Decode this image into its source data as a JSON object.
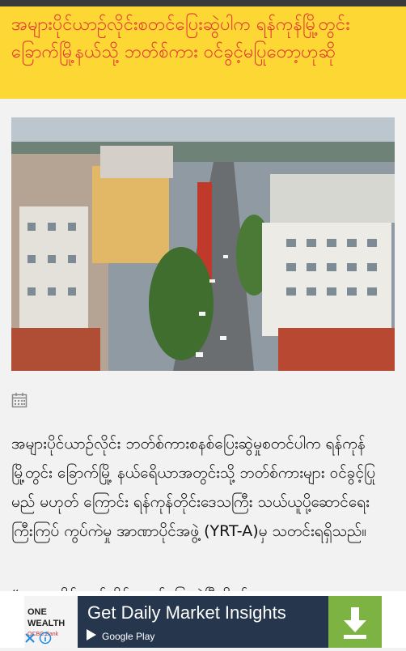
{
  "status_bar": {},
  "article": {
    "title": "အများပိုင်ယာဉ်လိုင်းစတင်ပြေးဆွဲပါက ရန်ကုန်မြို့တွင်း ခြောက်မြို့နယ်သို့ ဘတ်စ်ကား ဝင်ခွင့်မပြုတော့ဟုဆို",
    "photo_icon": "city-street-photo",
    "date_icon": "calendar-icon",
    "body": "အများပိုင်ယာဉ်လိုင်း ဘတ်စ်ကားစနစ်ပြေးဆွဲမှုစတင်ပါက ရန်ကုန်မြို့တွင်း ခြောက်မြို့ နယ်ရေိယာအတွင်းသို့ ဘတ်စ်ကားများ ဝင်ခွင့်ပြုမည် မဟုတ် ကြောင်း ရန်ကုန်တိုင်းဒေသကြီး သယ်ယူပို့ဆောင်ရေး ကြီးကြပ် ကွပ်ကဲမှု အာဏာပိုင်အဖွဲ့ (YRT-A)မှ သတင်းရရှိသည်။",
    "quote_fragment": "“ အများပိုင်ယာဉ်လိုင်းစတင်ပြေးဆွဲပြီဆိုရင်"
  },
  "ad": {
    "logo_line1": "ONE",
    "logo_line2": "WEALTH",
    "logo_line3": "OCBC Bank",
    "headline": "Get Daily Market Insights",
    "store_label": "Google Play",
    "store_icon": "google-play-icon",
    "download_icon": "download-icon",
    "close_icon": "close-icon",
    "info_icon": "info-icon",
    "colors": {
      "panel": "#25364d",
      "download": "#7cb342",
      "title_bg": "#fdd835",
      "title_text": "#e53935"
    }
  }
}
